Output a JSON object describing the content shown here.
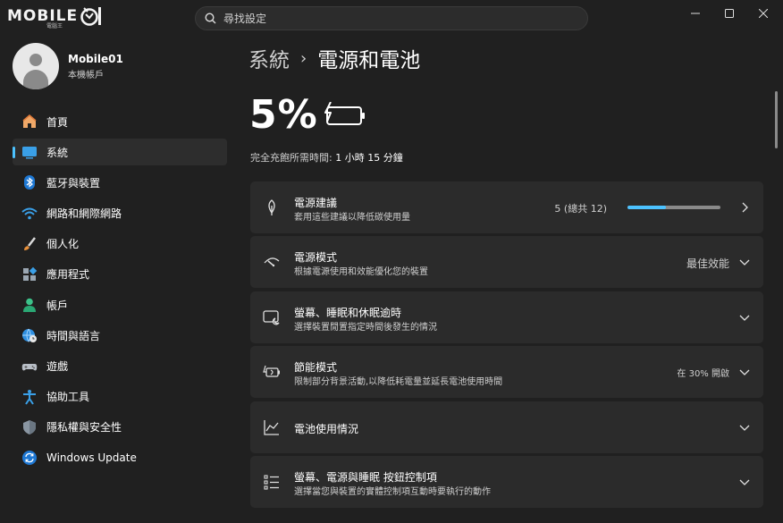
{
  "titlebar": {
    "logo_text": "MOBILE",
    "logo_sub": "電腦王",
    "search_placeholder": "尋找設定"
  },
  "profile": {
    "name": "Mobile01",
    "account_type": "本機帳戶"
  },
  "sidebar": {
    "items": [
      {
        "label": "首頁",
        "icon": "home-icon"
      },
      {
        "label": "系統",
        "icon": "monitor-icon",
        "active": true
      },
      {
        "label": "藍牙與裝置",
        "icon": "bluetooth-icon"
      },
      {
        "label": "網路和網際網路",
        "icon": "wifi-icon"
      },
      {
        "label": "個人化",
        "icon": "brush-icon"
      },
      {
        "label": "應用程式",
        "icon": "apps-icon"
      },
      {
        "label": "帳戶",
        "icon": "person-icon"
      },
      {
        "label": "時間與語言",
        "icon": "globe-clock-icon"
      },
      {
        "label": "遊戲",
        "icon": "gamepad-icon"
      },
      {
        "label": "協助工具",
        "icon": "accessibility-icon"
      },
      {
        "label": "隱私權與安全性",
        "icon": "shield-icon"
      },
      {
        "label": "Windows Update",
        "icon": "refresh-icon"
      }
    ]
  },
  "breadcrumb": {
    "parent": "系統",
    "separator": "›",
    "current": "電源和電池"
  },
  "battery": {
    "percent": "5%",
    "charge_label": "完全充飽所需時間:",
    "charge_value": "1 小時 15 分鐘"
  },
  "cards": [
    {
      "title": "電源建議",
      "subtitle": "套用這些建議以降低碳使用量",
      "right": "5 (總共 12)",
      "progress": 0.4167,
      "icon": "leaf-icon",
      "chevron": "right"
    },
    {
      "title": "電源模式",
      "subtitle": "根據電源使用和效能優化您的裝置",
      "right": "最佳效能",
      "icon": "gauge-icon",
      "chevron": "down"
    },
    {
      "title": "螢幕、睡眠和休眠逾時",
      "subtitle": "選擇裝置閒置指定時間後發生的情況",
      "right": "",
      "icon": "screen-sleep-icon",
      "chevron": "down"
    },
    {
      "title": "節能模式",
      "subtitle": "限制部分背景活動,以降低耗電量並延長電池使用時間",
      "right": "在 30% 開啟",
      "icon": "battery-saver-icon",
      "chevron": "down"
    },
    {
      "title": "電池使用情況",
      "subtitle": "",
      "right": "",
      "icon": "chart-line-icon",
      "chevron": "down"
    },
    {
      "title": "螢幕、電源與睡眠 按鈕控制項",
      "subtitle": "選擇當您與裝置的實體控制項互動時要執行的動作",
      "right": "",
      "icon": "list-icon",
      "chevron": "down"
    }
  ],
  "colors": {
    "background": "#202020",
    "card": "#2b2b2b",
    "accent": "#4cc2ff"
  }
}
